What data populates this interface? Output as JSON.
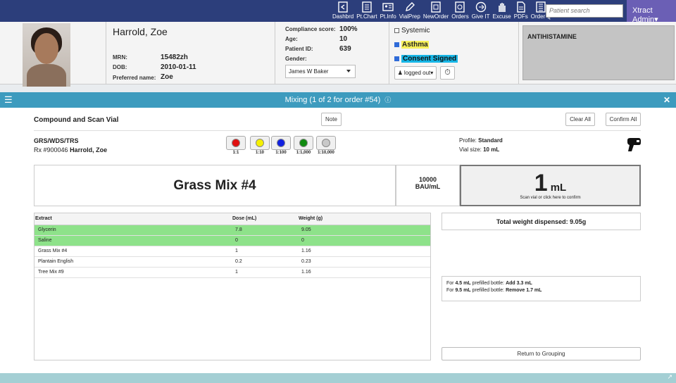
{
  "nav": {
    "items": [
      {
        "label": "Dashbrd",
        "icon": "arrow-left-box-icon"
      },
      {
        "label": "Pt.Chart",
        "icon": "chart-doc-icon"
      },
      {
        "label": "Pt.Info",
        "icon": "id-card-icon"
      },
      {
        "label": "VialPrep",
        "icon": "pencil-icon"
      },
      {
        "label": "NewOrder",
        "icon": "new-order-icon"
      },
      {
        "label": "Orders",
        "icon": "orders-icon"
      },
      {
        "label": "Give IT",
        "icon": "give-arrow-icon"
      },
      {
        "label": "Excuse",
        "icon": "hand-icon"
      },
      {
        "label": "PDFs",
        "icon": "pdf-icon"
      },
      {
        "label": "Order Q",
        "icon": "order-queue-icon"
      }
    ],
    "search_placeholder": "Patient search",
    "user": "Xtract Admin▾"
  },
  "patient": {
    "name": "Harrold, Zoe",
    "mrn_label": "MRN:",
    "mrn": "15482zh",
    "dob_label": "DOB:",
    "dob": "2010-01-11",
    "pref_label": "Preferred name:",
    "pref": "Zoe",
    "compliance_label": "Compliance score:",
    "compliance": "100%",
    "age_label": "Age:",
    "age": "10",
    "pid_label": "Patient ID:",
    "pid": "639",
    "gender_label": "Gender:",
    "gender": "",
    "provider": "James W Baker",
    "systemic": "Systemic",
    "asthma": "Asthma",
    "consent": "Consent Signed",
    "logged_out": "logged out▾",
    "alert": "ANTIHISTAMINE"
  },
  "mixing": {
    "title": "Mixing (1 of 2 for order #54)",
    "heading": "Compound and Scan Vial",
    "note_btn": "Note",
    "clear_btn": "Clear All",
    "confirm_btn": "Confirm All",
    "rx_code": "GRS/WDS/TRS",
    "rx_num": "Rx #900046",
    "rx_patient": "Harrold, Zoe",
    "dilutions": [
      {
        "label": "1:1",
        "color": "#e01010"
      },
      {
        "label": "1:10",
        "color": "#f5f000"
      },
      {
        "label": "1:100",
        "color": "#1020e0"
      },
      {
        "label": "1:1,000",
        "color": "#108a10"
      },
      {
        "label": "1:10,000",
        "color": "#c8c8c8"
      }
    ],
    "profile_label": "Profile:",
    "profile": "Standard",
    "vial_label": "Vial size:",
    "vial": "10 mL",
    "mix_name": "Grass Mix #4",
    "conc_num": "10000",
    "conc_unit": "BAU/mL",
    "vol_num": "1",
    "vol_unit": "mL",
    "scan_hint": "Scan vial or click here to confirm",
    "table_headers": [
      "Extract",
      "Dose (mL)",
      "Weight (g)"
    ],
    "rows": [
      {
        "extract": "Glycerin",
        "dose": "7.8",
        "weight": "9.05",
        "done": true
      },
      {
        "extract": "Saline",
        "dose": "0",
        "weight": "0",
        "done": true
      },
      {
        "extract": "Grass Mix #4",
        "dose": "1",
        "weight": "1.16",
        "done": false
      },
      {
        "extract": "Plantain English",
        "dose": "0.2",
        "weight": "0.23",
        "done": false
      },
      {
        "extract": "Tree Mix #9",
        "dose": "1",
        "weight": "1.16",
        "done": false
      }
    ],
    "total_label": "Total weight dispensed:",
    "total": "9.05g",
    "prefill1_a": "For",
    "prefill1_vol": "4.5 mL",
    "prefill1_b": "prefilled bottle:",
    "prefill1_act": "Add 3.3 mL",
    "prefill2_a": "For",
    "prefill2_vol": "9.5 mL",
    "prefill2_b": "prefilled bottle:",
    "prefill2_act": "Remove 1.7 mL",
    "return_btn": "Return to Grouping"
  }
}
